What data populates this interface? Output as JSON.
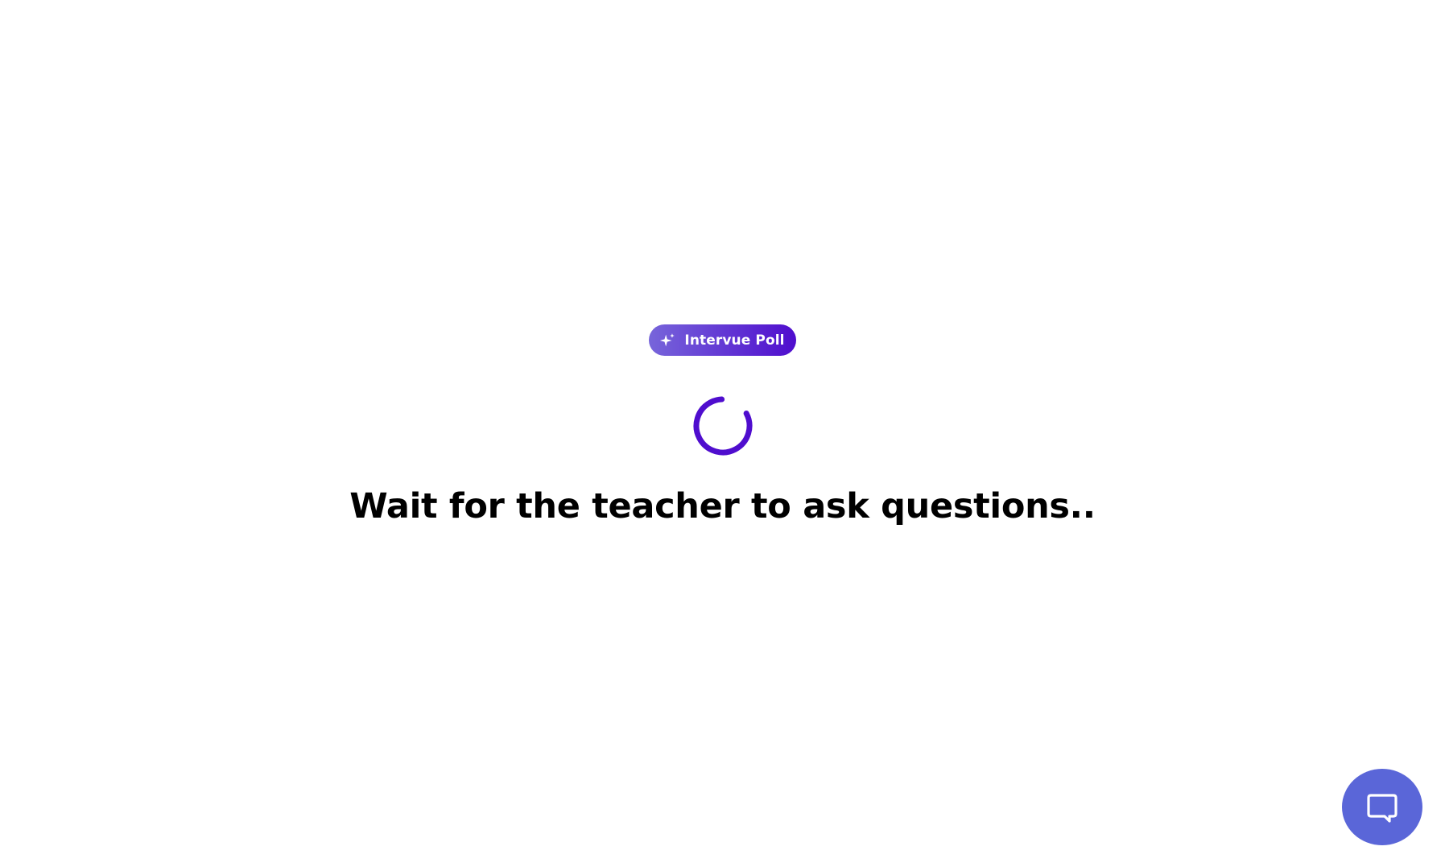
{
  "brand": {
    "label": "Intervue Poll",
    "icon": "sparkle-icon",
    "gradient_start": "#7765DA",
    "gradient_end": "#4F0DCE"
  },
  "loader": {
    "icon": "loading-spinner",
    "color": "#4F0DCE"
  },
  "waiting": {
    "message": "Wait for the teacher to ask questions.."
  },
  "chat": {
    "icon": "chat-bubble-icon",
    "color": "#5A66D8"
  }
}
